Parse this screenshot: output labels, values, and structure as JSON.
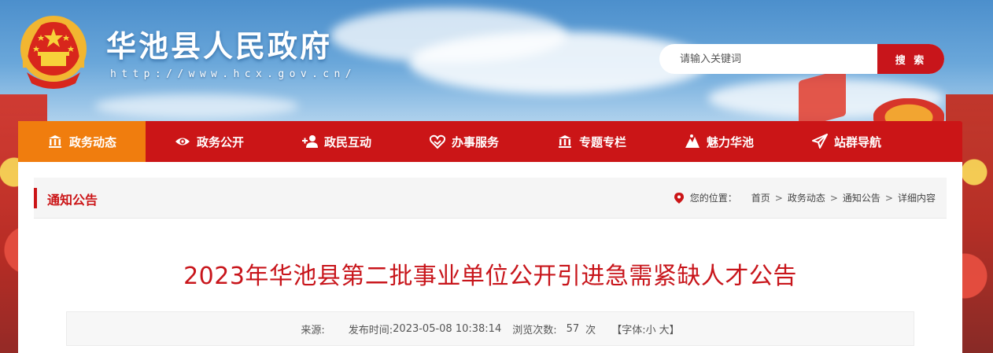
{
  "header": {
    "site_title": "华池县人民政府",
    "site_url": "http://www.hcx.gov.cn/",
    "emblem_icon": "national-emblem-icon"
  },
  "search": {
    "placeholder": "请输入关键词",
    "button_label": "搜 索"
  },
  "nav": {
    "items": [
      {
        "label": "政务动态",
        "icon": "building-icon"
      },
      {
        "label": "政务公开",
        "icon": "eye-icon"
      },
      {
        "label": "政民互动",
        "icon": "add-user-icon"
      },
      {
        "label": "办事服务",
        "icon": "handshake-heart-icon"
      },
      {
        "label": "专题专栏",
        "icon": "building-icon"
      },
      {
        "label": "魅力华池",
        "icon": "mountain-icon"
      },
      {
        "label": "站群导航",
        "icon": "send-icon"
      }
    ],
    "active_index": 0
  },
  "section": {
    "title": "通知公告",
    "location_label": "您的位置：",
    "breadcrumb": [
      "首页",
      "政务动态",
      "通知公告",
      "详细内容"
    ]
  },
  "article": {
    "title": "2023年华池县第二批事业单位公开引进急需紧缺人才公告",
    "source_label": "来源:",
    "source_value": "",
    "publish_label": "发布时间:",
    "publish_time": "2023-05-08 10:38:14",
    "views_label": "浏览次数:",
    "views_count": "57",
    "views_unit": "次",
    "font_label": "【字体:",
    "font_small": "小",
    "font_large": "大】"
  },
  "colors": {
    "primary_red": "#cb1517",
    "active_orange": "#f07d0e",
    "title_red": "#c8151b"
  }
}
